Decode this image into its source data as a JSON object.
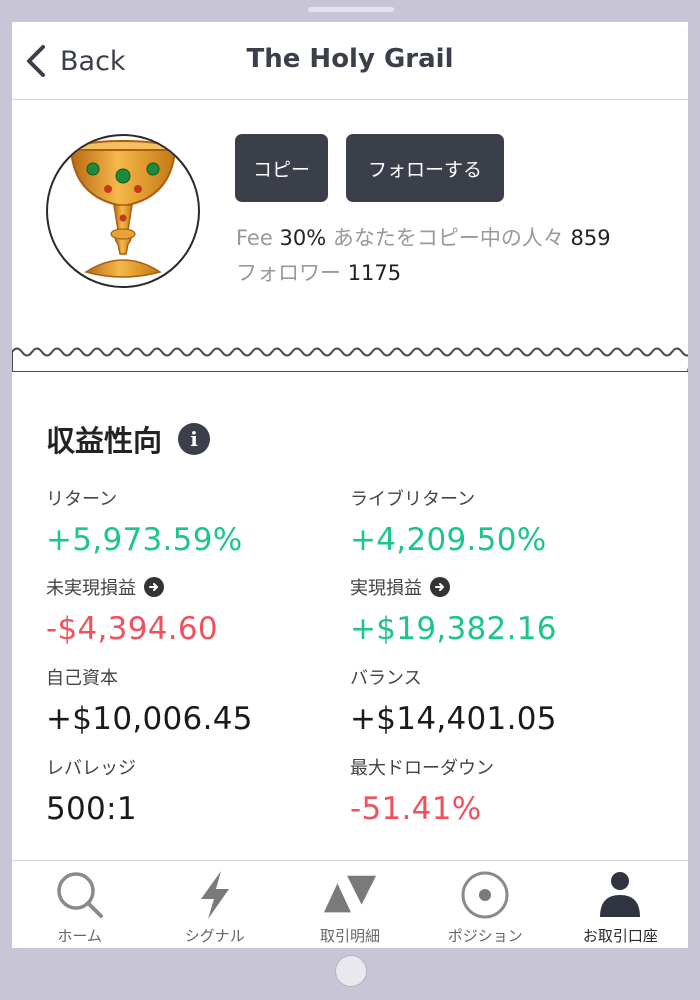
{
  "nav": {
    "back_label": "Back",
    "title": "The Holy Grail"
  },
  "profile": {
    "avatar_icon": "holy-grail-chalice-icon",
    "copy_button": "コピー",
    "follow_button": "フォローする",
    "fee_label": "Fee",
    "fee_value": "30%",
    "copiers_label": "あなたをコピー中の人々",
    "copiers_value": "859",
    "followers_label": "フォロワー",
    "followers_value": "1175"
  },
  "stats": {
    "title": "収益性向",
    "info_icon": "info-icon",
    "items": [
      {
        "label": "リターン",
        "value": "+5,973.59%",
        "tone": "positive"
      },
      {
        "label": "ライブリターン",
        "value": "+4,209.50%",
        "tone": "positive"
      },
      {
        "label": "未実現損益",
        "value": "-$4,394.60",
        "tone": "negative",
        "icon": "arrow-right-circle-icon"
      },
      {
        "label": "実現損益",
        "value": "+$19,382.16",
        "tone": "positive",
        "icon": "arrow-right-circle-icon"
      },
      {
        "label": "自己資本",
        "value": "+$10,006.45",
        "tone": "neutral"
      },
      {
        "label": "バランス",
        "value": "+$14,401.05",
        "tone": "neutral"
      },
      {
        "label": "レバレッジ",
        "value": "500:1",
        "tone": "neutral"
      },
      {
        "label": "最大ドローダウン",
        "value": "-51.41%",
        "tone": "negative"
      }
    ]
  },
  "tabs": [
    {
      "label": "ホーム",
      "icon": "search-icon",
      "active": false
    },
    {
      "label": "シグナル",
      "icon": "lightning-icon",
      "active": false
    },
    {
      "label": "取引明細",
      "icon": "trades-icon",
      "active": false
    },
    {
      "label": "ポジション",
      "icon": "position-icon",
      "active": false
    },
    {
      "label": "お取引口座",
      "icon": "account-icon",
      "active": true
    }
  ],
  "colors": {
    "accent_dark": "#3a3f4a",
    "positive": "#1cc58c",
    "negative": "#f0525c"
  }
}
